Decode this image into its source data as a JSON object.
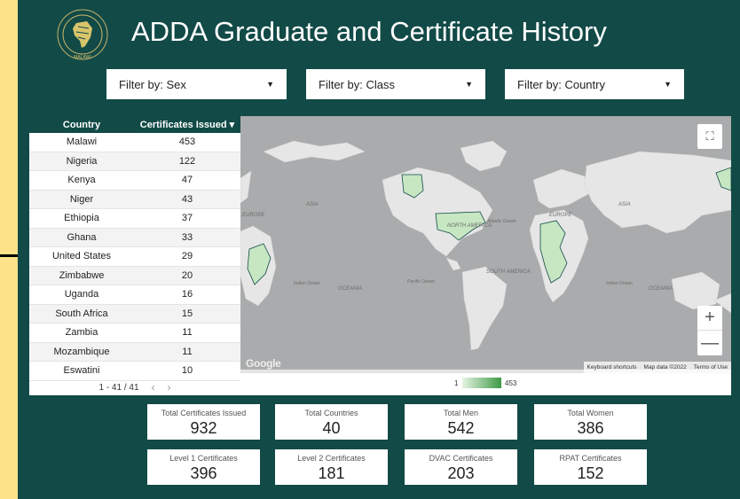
{
  "header": {
    "title": "ADDA Graduate and Certificate History",
    "logo_label": "MALAWI"
  },
  "filters": [
    {
      "label": "Filter by: Sex"
    },
    {
      "label": "Filter by: Class"
    },
    {
      "label": "Filter by: Country"
    }
  ],
  "table": {
    "columns": [
      "Country",
      "Certificates Issued"
    ],
    "sort_indicator": "▾",
    "rows": [
      {
        "country": "Malawi",
        "count": "453"
      },
      {
        "country": "Nigeria",
        "count": "122"
      },
      {
        "country": "Kenya",
        "count": "47"
      },
      {
        "country": "Niger",
        "count": "43"
      },
      {
        "country": "Ethiopia",
        "count": "37"
      },
      {
        "country": "Ghana",
        "count": "33"
      },
      {
        "country": "United States",
        "count": "29"
      },
      {
        "country": "Zimbabwe",
        "count": "20"
      },
      {
        "country": "Uganda",
        "count": "16"
      },
      {
        "country": "South Africa",
        "count": "15"
      },
      {
        "country": "Zambia",
        "count": "11"
      },
      {
        "country": "Mozambique",
        "count": "11"
      },
      {
        "country": "Eswatini",
        "count": "10"
      }
    ],
    "pager": "1 - 41 / 41",
    "prev": "‹",
    "next": "›"
  },
  "map": {
    "labels": {
      "europe1": "EUROPE",
      "europe2": "EUROPE",
      "asia1": "ASIA",
      "asia2": "ASIA",
      "north_america": "NORTH AMERICA",
      "south_america": "SOUTH AMERICA",
      "atlantic": "Atlantic Ocean",
      "pacific": "Pacific Ocean",
      "indian1": "Indian Ocean",
      "indian2": "Indian Ocean",
      "oceania1": "OCEANIA",
      "oceania2": "OCEANIA"
    },
    "fullscreen_icon": "⛶",
    "zoom_in": "+",
    "zoom_out": "—",
    "google_logo": "Google",
    "attribution": {
      "shortcuts": "Keyboard shortcuts",
      "map_data": "Map data ©2022",
      "terms": "Terms of Use"
    },
    "legend": {
      "min": "1",
      "max": "453",
      "colors": [
        "#e6f4e2",
        "#3e9a47"
      ]
    },
    "colors": {
      "water": "#aaabac",
      "land": "#e6e6e6",
      "highlight": "#c7e6c2",
      "border": "#124a47"
    }
  },
  "stats": [
    {
      "label": "Total Certificates Issued",
      "value": "932"
    },
    {
      "label": "Total Countries",
      "value": "40"
    },
    {
      "label": "Total Men",
      "value": "542"
    },
    {
      "label": "Total Women",
      "value": "386"
    },
    {
      "label": "Level 1 Certificates",
      "value": "396"
    },
    {
      "label": "Level 2 Certificates",
      "value": "181"
    },
    {
      "label": "DVAC Certificates",
      "value": "203"
    },
    {
      "label": "RPAT Certificates",
      "value": "152"
    }
  ]
}
